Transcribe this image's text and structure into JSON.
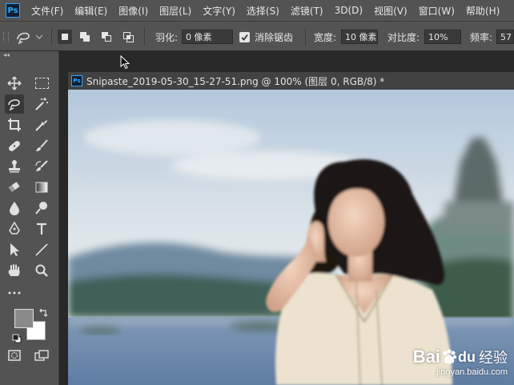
{
  "app": {
    "logo_text": "Ps"
  },
  "menu": [
    "文件(F)",
    "编辑(E)",
    "图像(I)",
    "图层(L)",
    "文字(Y)",
    "选择(S)",
    "滤镜(T)",
    "3D(D)",
    "视图(V)",
    "窗口(W)",
    "帮助(H)"
  ],
  "options": {
    "feather_label": "羽化:",
    "feather_value": "0 像素",
    "antialias_label": "消除锯齿",
    "width_label": "宽度:",
    "width_value": "10 像素",
    "contrast_label": "对比度:",
    "contrast_value": "10%",
    "frequency_label": "频率:",
    "frequency_value": "57"
  },
  "document": {
    "tab_title": "Snipaste_2019-05-30_15-27-51.png @ 100% (图层 0, RGB/8) *",
    "tab_icon_text": "Ps"
  },
  "colors": {
    "foreground": "#8a8a8a",
    "background": "#ffffff",
    "accent": "#31a8ff"
  },
  "watermark": {
    "brand": "Bai",
    "brand2": "du",
    "cn": "经验",
    "url": "jingyan.baidu.com"
  }
}
